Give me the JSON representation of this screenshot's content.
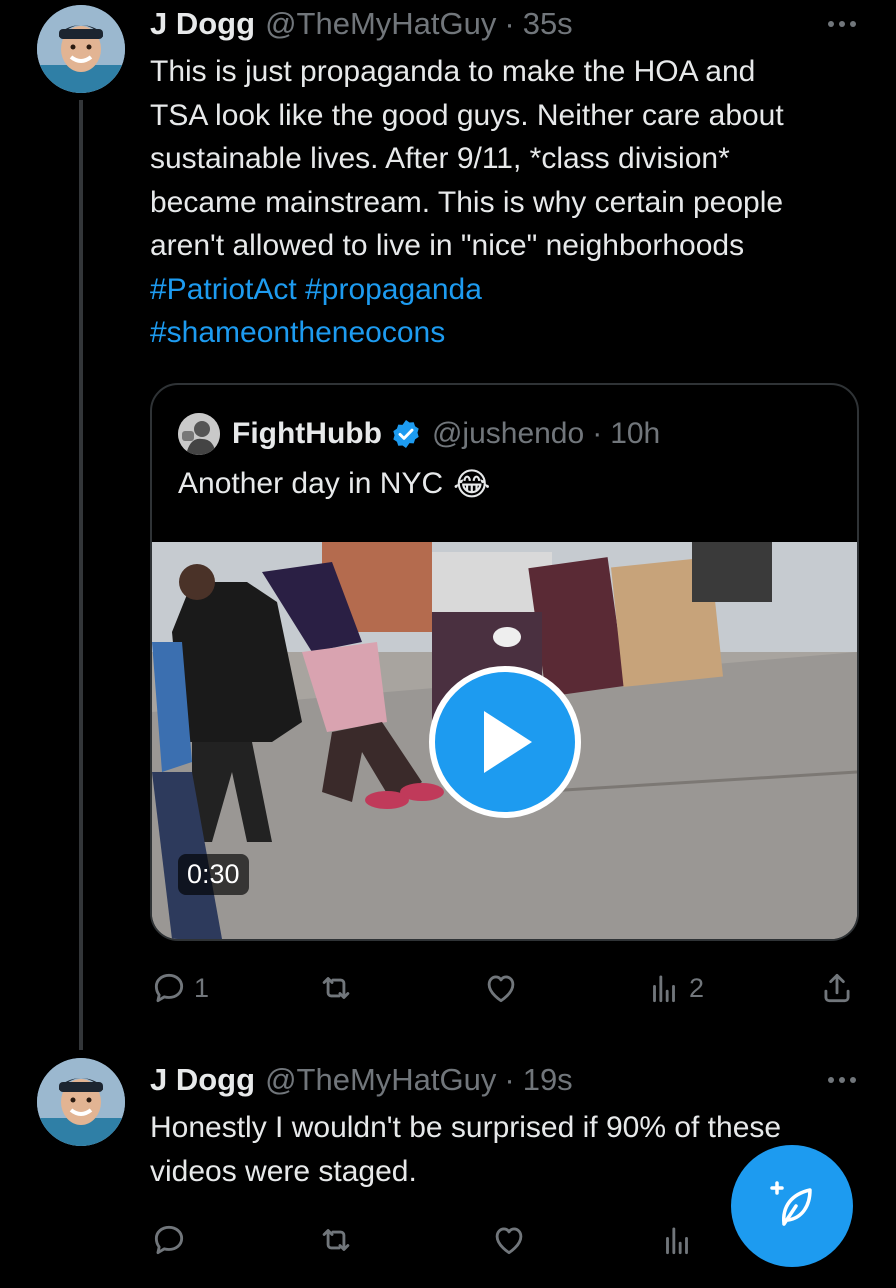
{
  "tweets": [
    {
      "name": "J Dogg",
      "handle": "@TheMyHatGuy",
      "separator": "·",
      "time": "35s",
      "text_lines": [
        "This is just propaganda to make the HOA and",
        "TSA look like the good guys. Neither care about",
        "sustainable lives. After 9/11, *class division*",
        "became mainstream. This is why certain people",
        "aren't allowed to live in \"nice\" neighborhoods"
      ],
      "hashtags_line1": [
        "#PatriotAct",
        "#propaganda"
      ],
      "hashtags_line2": [
        "#shameontheneocons"
      ],
      "quote": {
        "name": "FightHubb",
        "handle": "@jushendo",
        "separator": "·",
        "time": "10h",
        "text": "Another day in NYC",
        "emoji": "😂",
        "video_duration": "0:30"
      },
      "actions": {
        "reply_count": "1",
        "repost_count": "",
        "like_count": "",
        "views_count": "2"
      }
    },
    {
      "name": "J Dogg",
      "handle": "@TheMyHatGuy",
      "separator": "·",
      "time": "19s",
      "text_lines": [
        "Honestly I wouldn't be surprised if 90% of these",
        "videos were staged."
      ]
    }
  ],
  "colors": {
    "background": "#000000",
    "text": "#e7e9ea",
    "muted": "#71767b",
    "accent": "#1d9bf0",
    "border": "#2f3336"
  },
  "icons": {
    "reply": "reply-icon",
    "repost": "repost-icon",
    "like": "heart-icon",
    "views": "views-icon",
    "share": "share-icon",
    "more": "more-icon",
    "verified": "verified-badge-icon",
    "compose": "compose-icon",
    "play": "play-icon"
  }
}
